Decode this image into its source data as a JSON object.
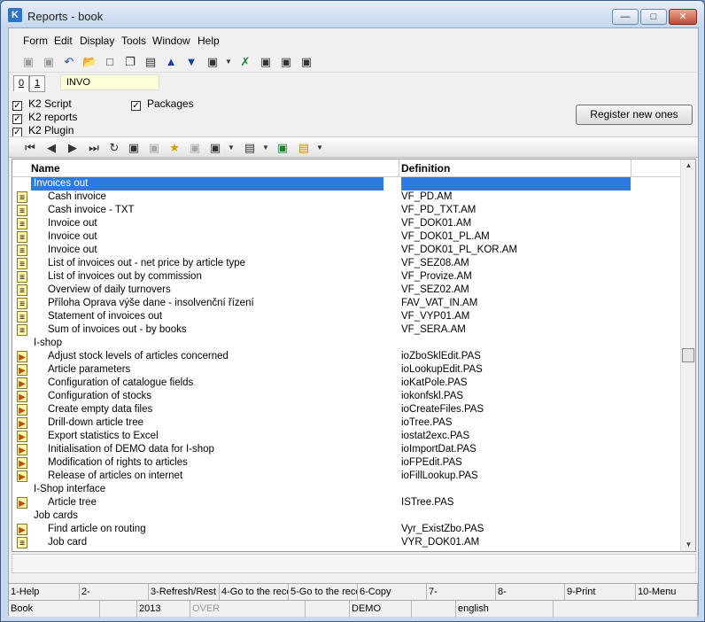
{
  "window": {
    "title": "Reports - book"
  },
  "menu": [
    "Form",
    "Edit",
    "Display",
    "Tools",
    "Window",
    "Help"
  ],
  "tabs": [
    "0",
    "1"
  ],
  "form_code": "INVO",
  "checkboxes": {
    "k2_script": "K2 Script",
    "k2_reports": "K2 reports",
    "k2_plugin": "K2 Plugin",
    "packages": "Packages"
  },
  "register_button": "Register new ones",
  "columns": {
    "name": "Name",
    "definition": "Definition"
  },
  "rows": [
    {
      "type": "group",
      "name": "Invoices out",
      "def": "",
      "selected": true
    },
    {
      "type": "doc",
      "name": "Cash invoice",
      "def": "VF_PD.AM"
    },
    {
      "type": "doc",
      "name": "Cash invoice - TXT",
      "def": "VF_PD_TXT.AM"
    },
    {
      "type": "doc",
      "name": "Invoice out",
      "def": "VF_DOK01.AM"
    },
    {
      "type": "doc",
      "name": "Invoice out",
      "def": "VF_DOK01_PL.AM"
    },
    {
      "type": "doc",
      "name": "Invoice out",
      "def": "VF_DOK01_PL_KOR.AM"
    },
    {
      "type": "doc",
      "name": "List of invoices out - net price by article type",
      "def": "VF_SEZ08.AM"
    },
    {
      "type": "doc",
      "name": "List of invoices out by commission",
      "def": "VF_Provize.AM"
    },
    {
      "type": "doc",
      "name": "Overview of daily turnovers",
      "def": "VF_SEZ02.AM"
    },
    {
      "type": "doc",
      "name": "Příloha Oprava výše dane - insolvenční řízení",
      "def": "FAV_VAT_IN.AM"
    },
    {
      "type": "doc",
      "name": "Statement of invoices out",
      "def": "VF_VYP01.AM"
    },
    {
      "type": "doc",
      "name": "Sum of invoices out - by books",
      "def": "VF_SERA.AM"
    },
    {
      "type": "group",
      "name": "I-shop",
      "def": ""
    },
    {
      "type": "script",
      "name": "Adjust stock levels of articles concerned",
      "def": "ioZboSklEdit.PAS"
    },
    {
      "type": "script",
      "name": "Article parameters",
      "def": "ioLookupEdit.PAS"
    },
    {
      "type": "script",
      "name": "Configuration of catalogue fields",
      "def": "ioKatPole.PAS"
    },
    {
      "type": "script",
      "name": "Configuration of stocks",
      "def": "iokonfskl.PAS"
    },
    {
      "type": "script",
      "name": "Create empty data files",
      "def": "ioCreateFiles.PAS"
    },
    {
      "type": "script",
      "name": "Drill-down article tree",
      "def": "ioTree.PAS"
    },
    {
      "type": "script",
      "name": "Export statistics to Excel",
      "def": "iostat2exc.PAS"
    },
    {
      "type": "script",
      "name": "Initialisation of DEMO data for I-shop",
      "def": "ioImportDat.PAS"
    },
    {
      "type": "script",
      "name": "Modification of rights to articles",
      "def": "ioFPEdit.PAS"
    },
    {
      "type": "script",
      "name": "Release of articles on internet",
      "def": "ioFillLookup.PAS"
    },
    {
      "type": "group",
      "name": "I-Shop interface",
      "def": ""
    },
    {
      "type": "script",
      "name": "Article tree",
      "def": "ISTree.PAS"
    },
    {
      "type": "group",
      "name": "Job cards",
      "def": ""
    },
    {
      "type": "script",
      "name": "Find article on routing",
      "def": "Vyr_ExistZbo.PAS"
    },
    {
      "type": "doc",
      "name": "Job card",
      "def": "VYR_DOK01.AM"
    }
  ],
  "fkeys": [
    "1-Help",
    "2-",
    "3-Refresh/Rest",
    "4-Go to the reco",
    "5-Go to the reco",
    "6-Copy",
    "7-",
    "8-",
    "9-Print",
    "10-Menu"
  ],
  "status": [
    "Book",
    "",
    "2013",
    "OVER",
    "",
    "DEMO",
    "",
    "english",
    ""
  ],
  "icons": {
    "doc": "report-document-icon",
    "script": "script-icon"
  }
}
